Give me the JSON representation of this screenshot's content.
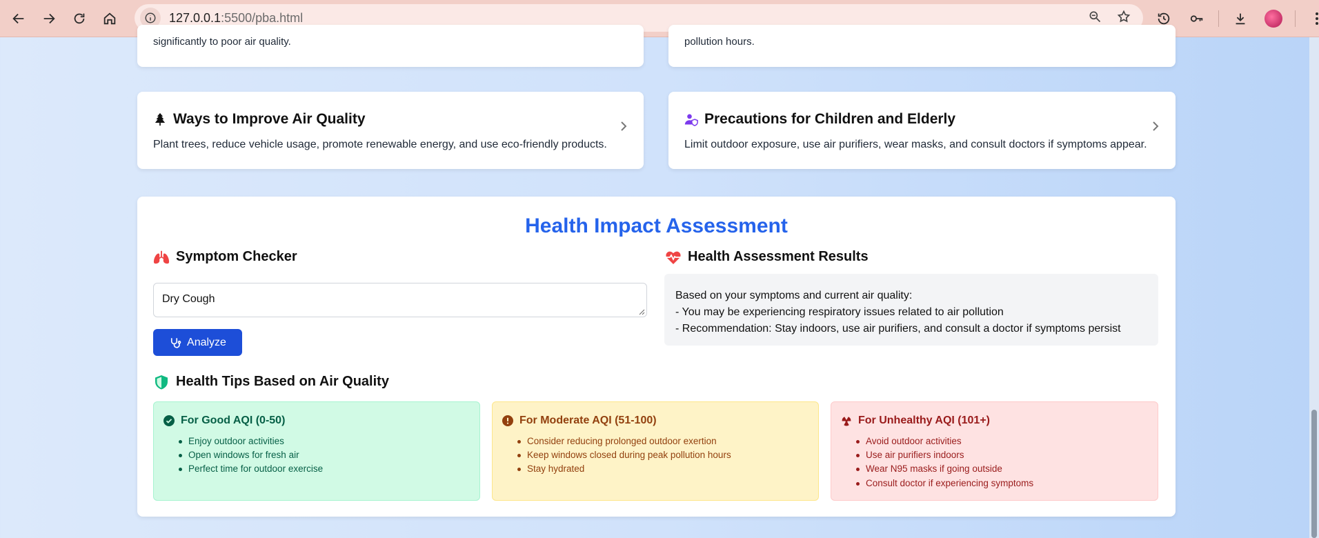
{
  "browser": {
    "url_host": "127.0.0.1",
    "url_rest": ":5500/pba.html"
  },
  "top_cards": {
    "left_text": "significantly to poor air quality.",
    "right_text": "pollution hours."
  },
  "info_cards": {
    "improve": {
      "icon": "tree-icon",
      "title": "Ways to Improve Air Quality",
      "description": "Plant trees, reduce vehicle usage, promote renewable energy, and use eco-friendly products."
    },
    "precautions": {
      "icon": "user-shield-icon",
      "title": "Precautions for Children and Elderly",
      "description": "Limit outdoor exposure, use air purifiers, wear masks, and consult doctors if symptoms appear."
    }
  },
  "assessment": {
    "title": "Health Impact Assessment",
    "symptom_checker": {
      "heading": "Symptom Checker",
      "input_value": "Dry Cough",
      "analyze_label": "Analyze"
    },
    "results": {
      "heading": "Health Assessment Results",
      "line1": "Based on your symptoms and current air quality:",
      "line2": "- You may be experiencing respiratory issues related to air pollution",
      "line3": "- Recommendation: Stay indoors, use air purifiers, and consult a doctor if symptoms persist"
    },
    "tips": {
      "heading": "Health Tips Based on Air Quality",
      "good": {
        "title": "For Good AQI (0-50)",
        "items": [
          "Enjoy outdoor activities",
          "Open windows for fresh air",
          "Perfect time for outdoor exercise"
        ]
      },
      "moderate": {
        "title": "For Moderate AQI (51-100)",
        "items": [
          "Consider reducing prolonged outdoor exertion",
          "Keep windows closed during peak pollution hours",
          "Stay hydrated"
        ]
      },
      "unhealthy": {
        "title": "For Unhealthy AQI (101+)",
        "items": [
          "Avoid outdoor activities",
          "Use air purifiers indoors",
          "Wear N95 masks if going outside",
          "Consult doctor if experiencing symptoms"
        ]
      }
    }
  },
  "colors": {
    "accent": "#2563eb",
    "button": "#1d4ed8",
    "good": "#065f46",
    "moderate": "#92400e",
    "unhealthy": "#991b1b"
  }
}
